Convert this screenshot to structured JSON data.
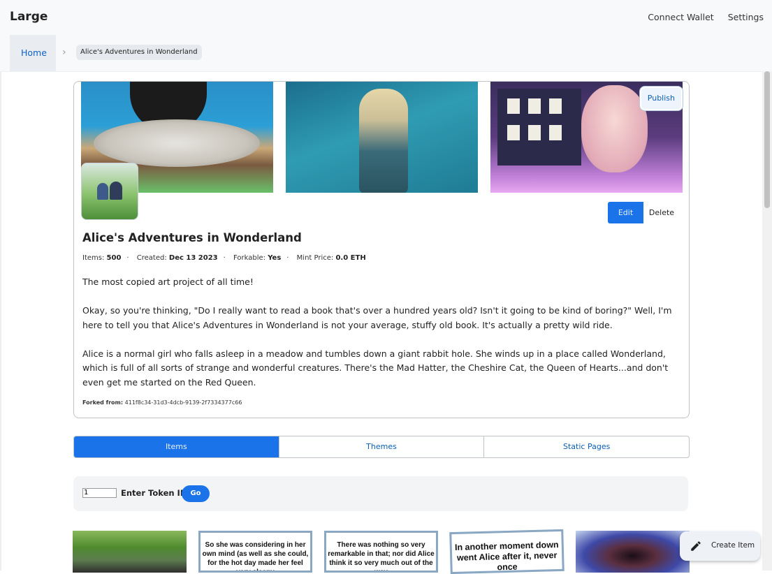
{
  "app": {
    "brand": "Large"
  },
  "topnav": {
    "connect_wallet": "Connect Wallet",
    "settings": "Settings"
  },
  "breadcrumb": {
    "home": "Home",
    "current": "Alice's Adventures in Wonderland"
  },
  "project": {
    "title": "Alice's Adventures in Wonderland",
    "items_label": "Items:",
    "items_value": "500",
    "created_label": "Created:",
    "created_value": "Dec 13 2023",
    "forkable_label": "Forkable:",
    "forkable_value": "Yes",
    "mint_label": "Mint Price:",
    "mint_value": "0.0 ETH",
    "description": [
      "The most copied art project of all time!",
      "Okay, so you're thinking, \"Do I really want to read a book that's over a hundred years old? Isn't it going to be kind of boring?\" Well, I'm here to tell you that Alice's Adventures in Wonderland is not your average, stuffy old book. It's actually a pretty wild ride.",
      "Alice is a normal girl who falls asleep in a meadow and tumbles down a giant rabbit hole. She winds up in a place called Wonderland, which is full of all sorts of strange and wonderful creatures. There's the Mad Hatter, the Cheshire Cat, the Queen of Hearts...and don't even get me started on the Red Queen."
    ],
    "forked_label": "Forked from:",
    "forked_value": "411f8c34-31d3-4dcb-9139-2f7334377c66",
    "publish_label": "Publish",
    "edit_label": "Edit",
    "delete_label": "Delete"
  },
  "tabs": [
    {
      "label": "Items",
      "active": true
    },
    {
      "label": "Themes",
      "active": false
    },
    {
      "label": "Static Pages",
      "active": false
    }
  ],
  "token": {
    "value": "1",
    "label": "Enter Token ID",
    "go_label": "Go"
  },
  "thumbnails": [
    {
      "text": ""
    },
    {
      "text": "So she was considering in her own mind (as well as she could, for the hot day made her feel very sleepy"
    },
    {
      "text": "There was nothing so very remarkable in that; nor did Alice think it so very much out of the way"
    },
    {
      "text": "In another moment down went Alice after it, never once"
    },
    {
      "text": ""
    }
  ],
  "create_item_label": "Create Item",
  "colors": {
    "accent": "#1a73e8",
    "link": "#0b5fb8",
    "card_border": "#bfc4c9"
  }
}
